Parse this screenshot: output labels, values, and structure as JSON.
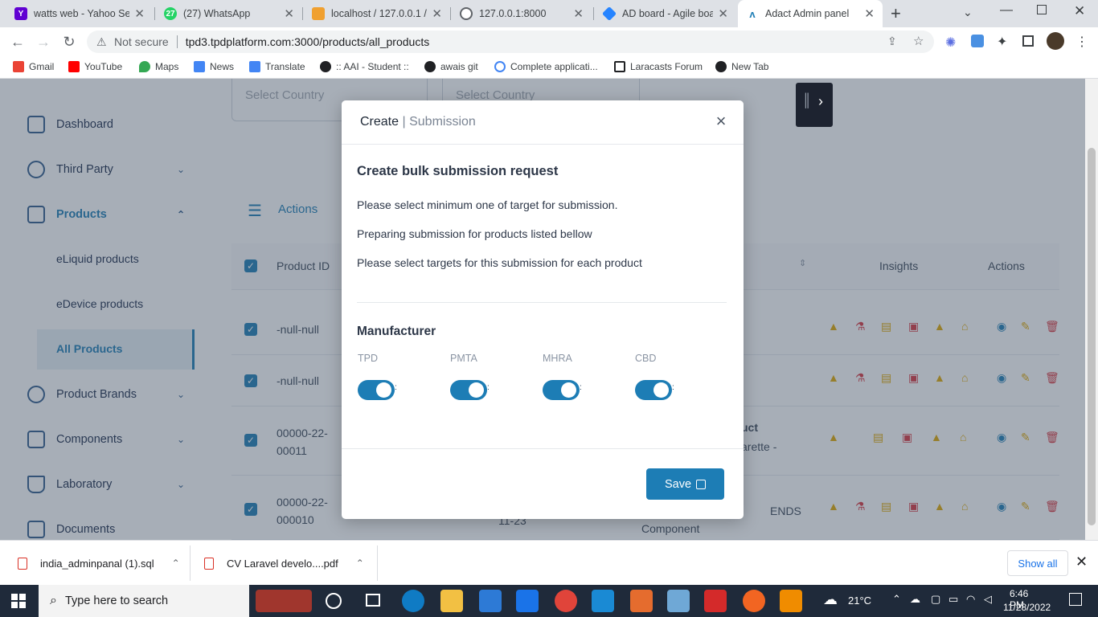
{
  "browser": {
    "tabs": [
      {
        "title": "watts web - Yahoo Sea",
        "favicon": "yahoo-icon",
        "color": "#6001d2",
        "glyph": "Y!"
      },
      {
        "title": "(27) WhatsApp",
        "favicon": "whatsapp-icon",
        "color": "#25d366",
        "glyph": "27"
      },
      {
        "title": "localhost / 127.0.0.1 /",
        "favicon": "phpmyadmin-icon",
        "color": "#f0a030",
        "glyph": "pma"
      },
      {
        "title": "127.0.0.1:8000",
        "favicon": "globe-icon",
        "color": "#5f6368",
        "glyph": ""
      },
      {
        "title": "AD board - Agile boar",
        "favicon": "jira-icon",
        "color": "#2684ff",
        "glyph": ""
      },
      {
        "title": "Adact Admin panel",
        "favicon": "adact-icon",
        "color": "#1d7db5",
        "glyph": "A"
      }
    ],
    "new_tab": "+",
    "not_secure": "Not secure",
    "url": "tpd3.tpdplatform.com:3000/products/all_products",
    "bookmarks": [
      {
        "label": "Gmail",
        "icon": "gmail-icon",
        "color": "#ea4335"
      },
      {
        "label": "YouTube",
        "icon": "youtube-icon",
        "color": "#ff0000"
      },
      {
        "label": "Maps",
        "icon": "maps-icon",
        "color": "#34a853"
      },
      {
        "label": "News",
        "icon": "news-icon",
        "color": "#4285f4"
      },
      {
        "label": "Translate",
        "icon": "translate-icon",
        "color": "#4285f4"
      },
      {
        "label": ":: AAI - Student ::",
        "icon": "globe-icon",
        "color": "#202124"
      },
      {
        "label": "awais git",
        "icon": "github-icon",
        "color": "#202124"
      },
      {
        "label": "Complete applicati...",
        "icon": "google-icon",
        "color": "#4285f4"
      },
      {
        "label": "Laracasts Forum",
        "icon": "laracasts-icon",
        "color": "#202124"
      },
      {
        "label": "New Tab",
        "icon": "globe-icon",
        "color": "#202124"
      }
    ]
  },
  "sidebar": {
    "items": [
      {
        "label": "Dashboard",
        "icon": "dashboard-icon"
      },
      {
        "label": "Third Party",
        "icon": "third-party-icon"
      },
      {
        "label": "Products",
        "icon": "products-icon"
      },
      {
        "label": "Product Brands",
        "icon": "gear-icon"
      },
      {
        "label": "Components",
        "icon": "components-icon"
      },
      {
        "label": "Laboratory",
        "icon": "flask-icon"
      },
      {
        "label": "Documents",
        "icon": "documents-icon"
      }
    ],
    "products_sub": [
      "eLiquid products",
      "eDevice products",
      "All Products"
    ],
    "chevrons": {
      "down": "⌄",
      "up": "⌃"
    }
  },
  "main": {
    "select_country_1": "Select Country",
    "select_country_2": "Select Country",
    "actions_label": "Actions",
    "columns": {
      "product_id": "Product ID",
      "insights": "Insights",
      "actions": "Actions"
    },
    "rows": [
      {
        "product_id": "-null-null"
      },
      {
        "product_id": "-null-null"
      },
      {
        "product_id": "00000-22-00011",
        "partial_a": "uct",
        "partial_b": "arette -"
      },
      {
        "product_id": "00000-22-000010",
        "partial_a": "ENDS",
        "partial_b": "Component",
        "partial_c": "11-23"
      }
    ]
  },
  "modal": {
    "title": "Create",
    "title_sub": "Submission",
    "close": "×",
    "heading": "Create bulk submission request",
    "line1": "Please select minimum one of target for submission.",
    "line2": "Preparing submission for products listed bellow",
    "line3": "Please select targets for this submission for each product",
    "section": "Manufacturer",
    "targets": [
      {
        "label": "TPD",
        "on": true
      },
      {
        "label": "PMTA",
        "on": true
      },
      {
        "label": "MHRA",
        "on": true
      },
      {
        "label": "CBD",
        "on": true
      }
    ],
    "toggle_tail": ":",
    "save": "Save"
  },
  "downloads": {
    "items": [
      {
        "name": "india_adminpanal (1).sql"
      },
      {
        "name": "CV Laravel  develo....pdf"
      }
    ],
    "show_all": "Show all"
  },
  "taskbar": {
    "search_placeholder": "Type here to search",
    "weather": "21°C",
    "time": "6:46 PM",
    "date": "11/28/2022"
  },
  "colors": {
    "accent": "#1d7db5",
    "warning": "#e0a800",
    "danger": "#d9363e"
  }
}
